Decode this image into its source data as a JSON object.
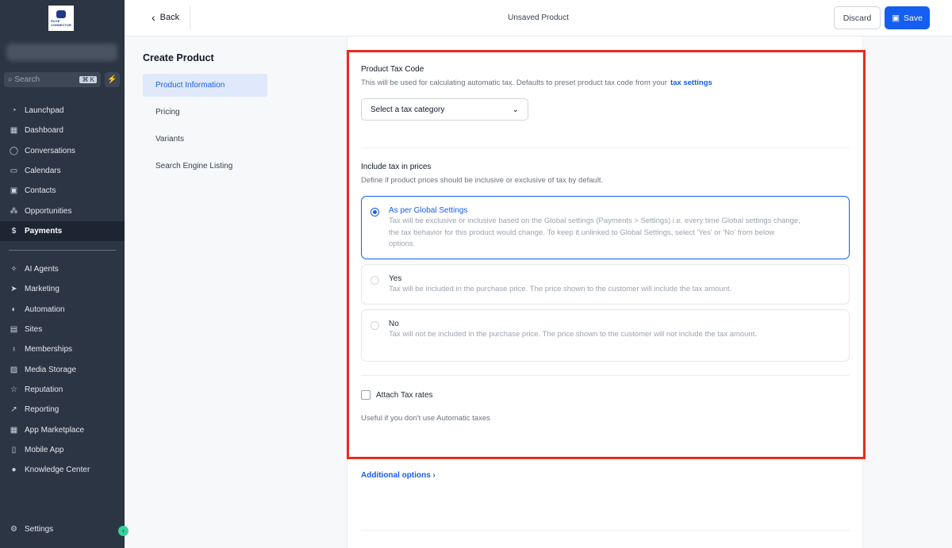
{
  "sidebar": {
    "logo_text": "ELITE CONNECTOR",
    "search_placeholder": "Search",
    "search_shortcut": "⌘ K",
    "items_top": [
      {
        "label": "Launchpad",
        "icon": "rocket-icon"
      },
      {
        "label": "Dashboard",
        "icon": "grid-icon"
      },
      {
        "label": "Conversations",
        "icon": "chat-icon"
      },
      {
        "label": "Calendars",
        "icon": "calendar-icon"
      },
      {
        "label": "Contacts",
        "icon": "contacts-icon"
      },
      {
        "label": "Opportunities",
        "icon": "opportunities-icon"
      },
      {
        "label": "Payments",
        "icon": "payments-icon",
        "active": true
      }
    ],
    "items_bottom": [
      {
        "label": "AI Agents",
        "icon": "sparkle-icon"
      },
      {
        "label": "Marketing",
        "icon": "send-icon"
      },
      {
        "label": "Automation",
        "icon": "automation-icon"
      },
      {
        "label": "Sites",
        "icon": "sites-icon"
      },
      {
        "label": "Memberships",
        "icon": "award-icon"
      },
      {
        "label": "Media Storage",
        "icon": "image-icon"
      },
      {
        "label": "Reputation",
        "icon": "star-icon"
      },
      {
        "label": "Reporting",
        "icon": "trend-icon"
      },
      {
        "label": "App Marketplace",
        "icon": "apps-icon"
      },
      {
        "label": "Mobile App",
        "icon": "mobile-icon"
      },
      {
        "label": "Knowledge Center",
        "icon": "info-icon"
      }
    ],
    "settings": "Settings"
  },
  "header": {
    "back": "Back",
    "title": "Unsaved Product",
    "discard": "Discard",
    "save": "Save"
  },
  "left_nav": {
    "title": "Create Product",
    "items": [
      "Product Information",
      "Pricing",
      "Variants",
      "Search Engine Listing"
    ]
  },
  "form": {
    "tax_code_label": "Product Tax Code",
    "tax_code_help": "This will be used for calculating automatic tax. Defaults to preset product tax code from your",
    "tax_settings_link": "tax settings",
    "tax_select_placeholder": "Select a tax category",
    "include_label": "Include tax in prices",
    "include_help": "Define if product prices should be inclusive or exclusive of tax by default.",
    "options": [
      {
        "title": "As per Global Settings",
        "desc": "Tax will be exclusive or inclusive based on the Global settings (Payments > Settings) i.e. every time Global settings change, the tax behavior for this product would change. To keep it unlinked to Global Settings, select 'Yes' or 'No' from below options.",
        "selected": true
      },
      {
        "title": "Yes",
        "desc": "Tax will be included in the purchase price. The price shown to the customer will include the tax amount.",
        "selected": false
      },
      {
        "title": "No",
        "desc": "Tax will not be included in the purchase price. The price shown to the customer will not include the tax amount.",
        "selected": false
      }
    ],
    "attach_label": "Attach Tax rates",
    "attach_help": "Useful if you don't use Automatic taxes",
    "additional_options": "Additional options"
  },
  "colors": {
    "accent": "#155eef",
    "highlight": "#ec2a20",
    "sidebar": "#2c3544"
  }
}
